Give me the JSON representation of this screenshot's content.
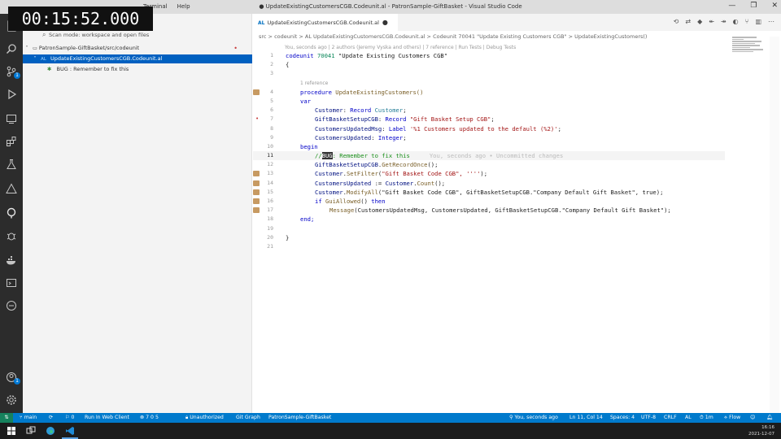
{
  "timer": "00:15:52.000",
  "titlebar": {
    "menus": [
      "Terminal",
      "Help"
    ],
    "title": "● UpdateExistingCustomersCGB.Codeunit.al - PatronSample-GiftBasket - Visual Studio Code",
    "minimize": "—",
    "restore": "❐",
    "close": "✕"
  },
  "activity_icons": [
    "files-icon",
    "search-icon",
    "source-control-icon",
    "run-debug-icon",
    "remote-explorer-icon",
    "extensions-icon",
    "testing-icon",
    "al-objects-icon",
    "git-lens-icon",
    "bug-explorer-icon",
    "docker-icon",
    "terminal-panel-icon",
    "gitlens-history-icon",
    "accounts-icon",
    "settings-icon"
  ],
  "activity_badges": {
    "source_control": "1",
    "accounts": "1"
  },
  "sidebar": {
    "search_placeholder": "Scan mode: workspace and open files",
    "folder": "PatronSample-GiftBasket/src/codeunit",
    "file": "UpdateExistingCustomersCGB.Codeunit.al",
    "bug": "BUG : Remember to fix this"
  },
  "tab": {
    "lang": "AL",
    "label": "UpdateExistingCustomersCGB.Codeunit.al",
    "modified": "●"
  },
  "breadcrumb": "src > codeunit > AL UpdateExistingCustomersCGB.Codeunit.al > Codeunit 70041 \"Update Existing Customers CGB\" > UpdateExistingCustomers()",
  "lens_top": "You, seconds ago | 2 authors (Jeremy Vyska and others) | 7 reference | Run Tests | Debug Tests",
  "lens_proc": "1 reference",
  "ghost_text": "You, seconds ago • Uncommitted changes",
  "code": {
    "l1_kw": "codeunit",
    "l1_num": "70041",
    "l1_str": "\"Update Existing Customers CGB\"",
    "l2": "{",
    "l4_kw": "procedure",
    "l4_name": "UpdateExistingCustomers()",
    "l5": "var",
    "l6_var": "Customer",
    "l6_type": "Record",
    "l6_obj": "Customer",
    "l7_var": "GiftBasketSetupCGB",
    "l7_type": "Record",
    "l7_obj": "\"Gift Basket Setup CGB\"",
    "l8_var": "CustomersUpdatedMsg",
    "l8_type": "Label",
    "l8_str": "'%1 Customers updated to the default (%2)'",
    "l9_var": "CustomersUpdated",
    "l9_type": "Integer",
    "l10": "begin",
    "l11_pre": "//",
    "l11_sel": "BUG",
    "l11_rest": ": Remember to fix this",
    "l12_obj": "GiftBasketSetupCGB",
    "l12_m": "GetRecordOnce",
    "l13_obj": "Customer",
    "l13_m": "SetFilter",
    "l13_args": "\"Gift Basket Code CGB\", ''''",
    "l14_var": "CustomersUpdated",
    "l14_rest": "Customer",
    "l14_m": "Count",
    "l15_obj": "Customer",
    "l15_m": "ModifyAll",
    "l15_args": "\"Gift Basket Code CGB\", GiftBasketSetupCGB.\"Company Default Gift Basket\", true",
    "l16_kw": "if",
    "l16_fn": "GuiAllowed",
    "l16_then": "then",
    "l17_fn": "Message",
    "l17_args": "CustomersUpdatedMsg, CustomersUpdated, GiftBasketSetupCGB.\"Company Default Gift Basket\"",
    "l18": "end;",
    "l20": "}"
  },
  "line_numbers": [
    "1",
    "2",
    "3",
    "4",
    "5",
    "6",
    "7",
    "8",
    "9",
    "10",
    "11",
    "12",
    "13",
    "14",
    "15",
    "16",
    "17",
    "18",
    "19",
    "20",
    "21"
  ],
  "status": {
    "branch": "main",
    "errors": "0",
    "run": "Run In Web Client",
    "problems": "7  0  5",
    "auth": "Unauthorized",
    "git_graph": "Git Graph",
    "workspace": "PatronSample-GiftBasket",
    "blame": "You, seconds ago",
    "position": "Ln 11, Col 14",
    "spaces": "Spaces: 4",
    "encoding": "UTF-8",
    "eol": "CRLF",
    "lang": "AL",
    "timer": "1m",
    "flow": "Flow"
  },
  "taskbar": {
    "time": "16:16",
    "date": "2021-12-07"
  }
}
